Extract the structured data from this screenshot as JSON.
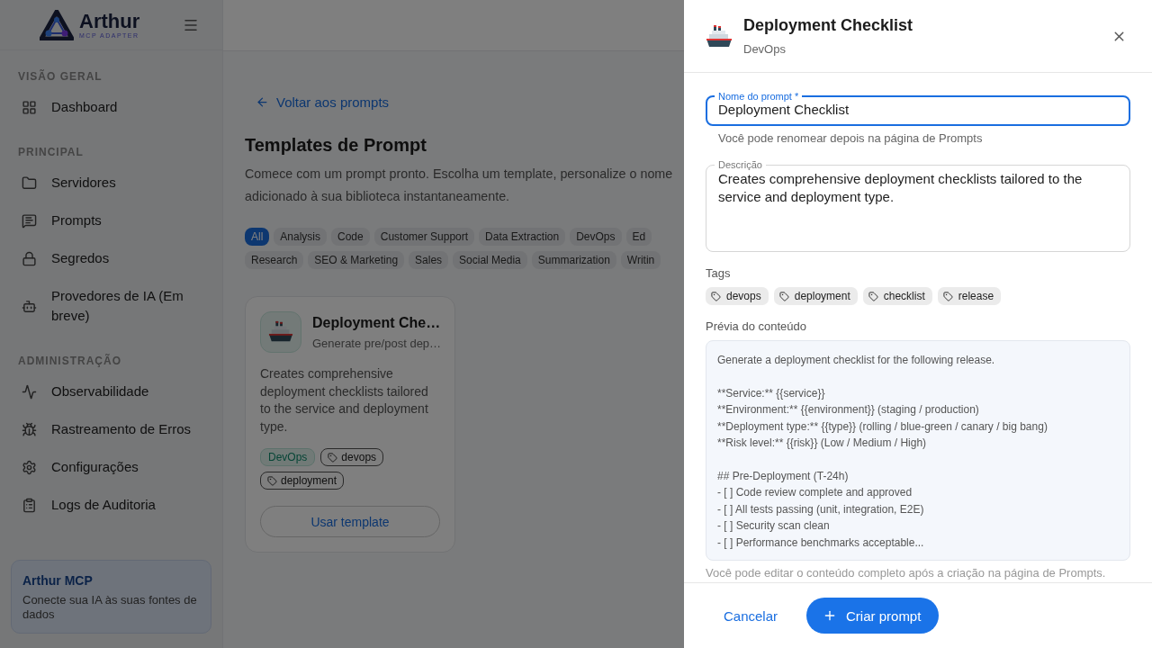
{
  "sidebar": {
    "brand": "Arthur",
    "brand_sub": "MCP ADAPTER",
    "sections": [
      {
        "heading": "VISÃO GERAL",
        "items": [
          {
            "label": "Dashboard"
          }
        ]
      },
      {
        "heading": "PRINCIPAL",
        "items": [
          {
            "label": "Servidores"
          },
          {
            "label": "Prompts"
          },
          {
            "label": "Segredos"
          },
          {
            "label": "Provedores de IA (Em breve)"
          }
        ]
      },
      {
        "heading": "ADMINISTRAÇÃO",
        "items": [
          {
            "label": "Observabilidade"
          },
          {
            "label": "Rastreamento de Erros"
          },
          {
            "label": "Configurações"
          },
          {
            "label": "Logs de Auditoria"
          }
        ]
      }
    ],
    "promo": {
      "title": "Arthur MCP",
      "text": "Conecte sua IA às suas fontes de dados"
    }
  },
  "main": {
    "back_link": "Voltar aos prompts",
    "title": "Templates de Prompt",
    "description_lines": [
      "Comece com um prompt pronto. Escolha um template, personalize o nome",
      "adicionado à sua biblioteca instantaneamente."
    ],
    "category_rows": [
      [
        {
          "label": "All",
          "selected": true
        },
        {
          "label": "Analysis",
          "selected": false
        },
        {
          "label": "Code",
          "selected": false
        },
        {
          "label": "Customer Support",
          "selected": false
        },
        {
          "label": "Data Extraction",
          "selected": false
        },
        {
          "label": "DevOps",
          "selected": false
        },
        {
          "label": "Ed",
          "selected": false
        }
      ],
      [
        {
          "label": "Research",
          "selected": false
        },
        {
          "label": "SEO & Marketing",
          "selected": false
        },
        {
          "label": "Sales",
          "selected": false
        },
        {
          "label": "Social Media",
          "selected": false
        },
        {
          "label": "Summarization",
          "selected": false
        },
        {
          "label": "Writin",
          "selected": false
        }
      ]
    ],
    "cards": [
      {
        "title": "Deployment Che…",
        "subtitle": "Generate pre/post dep…",
        "description": "Creates comprehensive deployment checklists tailored to the service and deployment type.",
        "category": "DevOps",
        "tags": [
          "devops",
          "deployment"
        ],
        "action": "Usar template"
      }
    ]
  },
  "drawer": {
    "title": "Deployment Checklist",
    "subtitle": "DevOps",
    "name_field": {
      "label": "Nome do prompt *",
      "value": "Deployment Checklist",
      "focused": true,
      "hint": "Você pode renomear depois na página de Prompts"
    },
    "description_field": {
      "label": "Descrição",
      "value": "Creates comprehensive deployment checklists tailored to the service and deployment type."
    },
    "tags_label": "Tags",
    "tags": [
      "devops",
      "deployment",
      "checklist",
      "release"
    ],
    "preview_label": "Prévia do conteúdo",
    "preview_blocks": [
      [
        "Generate a deployment checklist for the following release."
      ],
      [
        "**Service:** {{service}}",
        "**Environment:** {{environment}} (staging / production)",
        "**Deployment type:** {{type}} (rolling / blue-green / canary / big bang)",
        "**Risk level:** {{risk}} (Low / Medium / High)"
      ],
      [
        "## Pre-Deployment (T-24h)",
        "- [ ] Code review complete and approved",
        "- [ ] All tests passing (unit, integration, E2E)",
        "- [ ] Security scan clean",
        "- [ ] Performance benchmarks acceptable..."
      ]
    ],
    "preview_note": "Você pode editar o conteúdo completo após a criação na página de Prompts.",
    "cancel": "Cancelar",
    "submit": "Criar prompt"
  }
}
